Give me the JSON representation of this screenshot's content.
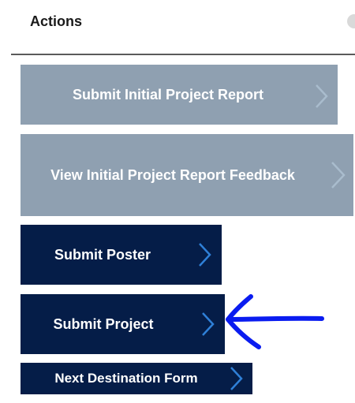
{
  "header": {
    "title": "Actions"
  },
  "actions": [
    {
      "label": "Submit Initial Project Report",
      "state": "disabled"
    },
    {
      "label": "View Initial Project Report Feedback",
      "state": "disabled"
    },
    {
      "label": "Submit Poster",
      "state": "enabled"
    },
    {
      "label": "Submit Project",
      "state": "enabled"
    },
    {
      "label": "Next Destination Form",
      "state": "enabled"
    }
  ],
  "annotation": {
    "icon": "hand-drawn-arrow-icon",
    "color": "#0a1cf0",
    "points_to": "Submit Project"
  },
  "colors": {
    "disabled_button": "#8fa0b1",
    "enabled_button": "#051d48",
    "chevron_enabled": "#2f80d8",
    "chevron_disabled": "#a9bccd"
  }
}
